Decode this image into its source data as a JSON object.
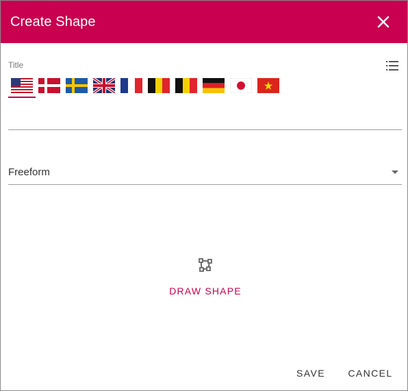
{
  "dialog": {
    "title": "Create Shape",
    "close_icon": "close-icon"
  },
  "title_field": {
    "label": "Title",
    "value": "",
    "list_icon": "list-icon",
    "languages": [
      {
        "code": "us",
        "icon": "flag-us-icon",
        "selected": true
      },
      {
        "code": "dk",
        "icon": "flag-dk-icon",
        "selected": false
      },
      {
        "code": "se",
        "icon": "flag-se-icon",
        "selected": false
      },
      {
        "code": "gb",
        "icon": "flag-gb-icon",
        "selected": false
      },
      {
        "code": "fr",
        "icon": "flag-fr-icon",
        "selected": false
      },
      {
        "code": "be",
        "icon": "flag-be-icon",
        "selected": false
      },
      {
        "code": "be2",
        "icon": "flag-be-icon",
        "selected": false
      },
      {
        "code": "de",
        "icon": "flag-de-icon",
        "selected": false
      },
      {
        "code": "jp",
        "icon": "flag-jp-icon",
        "selected": false
      },
      {
        "code": "vn",
        "icon": "flag-vn-icon",
        "selected": false
      }
    ]
  },
  "shape_type": {
    "selected": "Freeform"
  },
  "draw": {
    "icon": "draw-shape-icon",
    "label": "DRAW SHAPE"
  },
  "actions": {
    "save_label": "SAVE",
    "cancel_label": "CANCEL"
  },
  "colors": {
    "accent": "#c8004f"
  }
}
